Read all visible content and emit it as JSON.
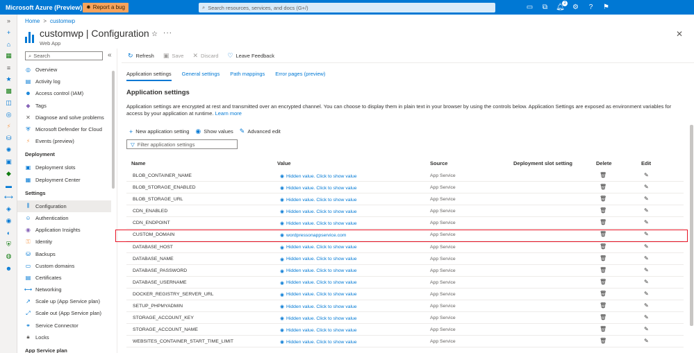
{
  "topbar": {
    "brand": "Microsoft Azure (Preview)",
    "bug_label": "Report a bug",
    "search_placeholder": "Search resources, services, and docs (G+/)",
    "notifications_count": "1"
  },
  "breadcrumb": [
    "Home",
    "customwp"
  ],
  "header": {
    "title": "customwp | Configuration",
    "subtitle": "Web App"
  },
  "left_menu": {
    "search_placeholder": "Search",
    "groups": [
      {
        "title": "",
        "items": [
          "Overview",
          "Activity log",
          "Access control (IAM)",
          "Tags",
          "Diagnose and solve problems",
          "Microsoft Defender for Cloud",
          "Events (preview)"
        ]
      },
      {
        "title": "Deployment",
        "items": [
          "Deployment slots",
          "Deployment Center"
        ]
      },
      {
        "title": "Settings",
        "items": [
          "Configuration",
          "Authentication",
          "Application Insights",
          "Identity",
          "Backups",
          "Custom domains",
          "Certificates",
          "Networking",
          "Scale up (App Service plan)",
          "Scale out (App Service plan)",
          "Service Connector",
          "Locks"
        ]
      },
      {
        "title": "App Service plan",
        "items": []
      }
    ],
    "active_item": "Configuration"
  },
  "toolbar": {
    "refresh": "Refresh",
    "save": "Save",
    "discard": "Discard",
    "feedback": "Leave Feedback"
  },
  "tabs": [
    "Application settings",
    "General settings",
    "Path mappings",
    "Error pages (preview)"
  ],
  "section": {
    "title": "Application settings",
    "description": "Application settings are encrypted at rest and transmitted over an encrypted channel. You can choose to display them in plain text in your browser by using the controls below. Application Settings are exposed as environment variables for access by your application at runtime.",
    "learn_more": "Learn more"
  },
  "actions": {
    "new_setting": "New application setting",
    "show_values": "Show values",
    "advanced_edit": "Advanced edit"
  },
  "filter_placeholder": "Filter application settings",
  "table": {
    "headers": [
      "Name",
      "Value",
      "Source",
      "Deployment slot setting",
      "Delete",
      "Edit"
    ],
    "rows": [
      {
        "name": "BLOB_CONTAINER_NAME",
        "value": "Hidden value. Click to show value",
        "source": "App Service"
      },
      {
        "name": "BLOB_STORAGE_ENABLED",
        "value": "Hidden value. Click to show value",
        "source": "App Service"
      },
      {
        "name": "BLOB_STORAGE_URL",
        "value": "Hidden value. Click to show value",
        "source": "App Service"
      },
      {
        "name": "CDN_ENABLED",
        "value": "Hidden value. Click to show value",
        "source": "App Service"
      },
      {
        "name": "CDN_ENDPOINT",
        "value": "Hidden value. Click to show value",
        "source": "App Service"
      },
      {
        "name": "CUSTOM_DOMAIN",
        "value": "wordpressonappservice.com",
        "source": "App Service"
      },
      {
        "name": "DATABASE_HOST",
        "value": "Hidden value. Click to show value",
        "source": "App Service"
      },
      {
        "name": "DATABASE_NAME",
        "value": "Hidden value. Click to show value",
        "source": "App Service"
      },
      {
        "name": "DATABASE_PASSWORD",
        "value": "Hidden value. Click to show value",
        "source": "App Service"
      },
      {
        "name": "DATABASE_USERNAME",
        "value": "Hidden value. Click to show value",
        "source": "App Service"
      },
      {
        "name": "DOCKER_REGISTRY_SERVER_URL",
        "value": "Hidden value. Click to show value",
        "source": "App Service"
      },
      {
        "name": "SETUP_PHPMYADMIN",
        "value": "Hidden value. Click to show value",
        "source": "App Service"
      },
      {
        "name": "STORAGE_ACCOUNT_KEY",
        "value": "Hidden value. Click to show value",
        "source": "App Service"
      },
      {
        "name": "STORAGE_ACCOUNT_NAME",
        "value": "Hidden value. Click to show value",
        "source": "App Service"
      },
      {
        "name": "WEBSITES_CONTAINER_START_TIME_LIMIT",
        "value": "Hidden value. Click to show value",
        "source": "App Service"
      }
    ]
  },
  "colors": {
    "accent": "#0078d4",
    "highlight": "#e81123",
    "bug": "#f7a35c"
  }
}
